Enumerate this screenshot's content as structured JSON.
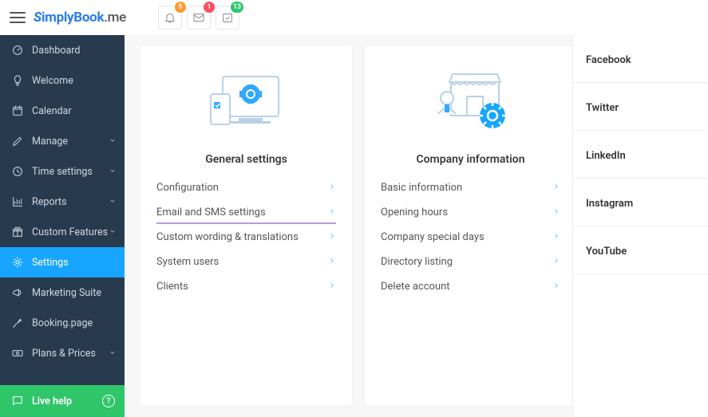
{
  "brand": {
    "name": "SimplyBook",
    "suffix": ".me"
  },
  "header": {
    "notifications_badge": "5",
    "messages_badge": "1",
    "tasks_badge": "13"
  },
  "sidebar": {
    "items": [
      {
        "label": "Dashboard",
        "icon": "dashboard-icon",
        "expandable": false
      },
      {
        "label": "Welcome",
        "icon": "bulb-icon",
        "expandable": false
      },
      {
        "label": "Calendar",
        "icon": "calendar-icon",
        "expandable": false
      },
      {
        "label": "Manage",
        "icon": "pencil-icon",
        "expandable": true
      },
      {
        "label": "Time settings",
        "icon": "clock-icon",
        "expandable": true
      },
      {
        "label": "Reports",
        "icon": "chart-icon",
        "expandable": true
      },
      {
        "label": "Custom Features",
        "icon": "gift-icon",
        "expandable": true
      },
      {
        "label": "Settings",
        "icon": "gear-icon",
        "expandable": false,
        "active": true
      },
      {
        "label": "Marketing Suite",
        "icon": "megaphone-icon",
        "expandable": false
      },
      {
        "label": "Booking.page",
        "icon": "booking-icon",
        "expandable": false
      },
      {
        "label": "Plans & Prices",
        "icon": "money-icon",
        "expandable": true
      }
    ],
    "help_label": "Live help"
  },
  "cards": [
    {
      "title": "General settings",
      "links": [
        {
          "label": "Configuration"
        },
        {
          "label": "Email and SMS settings",
          "highlight": true
        },
        {
          "label": "Custom wording & translations"
        },
        {
          "label": "System users"
        },
        {
          "label": "Clients"
        }
      ]
    },
    {
      "title": "Company information",
      "links": [
        {
          "label": "Basic information"
        },
        {
          "label": "Opening hours"
        },
        {
          "label": "Company special days"
        },
        {
          "label": "Directory listing"
        },
        {
          "label": "Delete account"
        }
      ]
    }
  ],
  "rightpanel": [
    "Facebook",
    "Twitter",
    "LinkedIn",
    "Instagram",
    "YouTube"
  ]
}
